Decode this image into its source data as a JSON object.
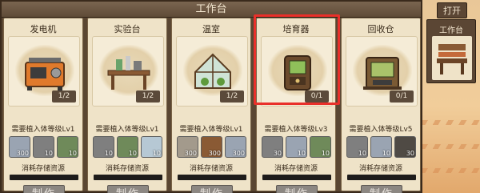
{
  "header": {
    "title": "工作台"
  },
  "side": {
    "open_label": "打开",
    "card_label": "工作台"
  },
  "cards": [
    {
      "name": "发电机",
      "count": "1/2",
      "requirement": "需要植入体等级Lv1",
      "materials": [
        {
          "icon": "crystal-ore-icon",
          "qty": "300"
        },
        {
          "icon": "iron-bar-icon",
          "qty": "10"
        },
        {
          "icon": "circuit-board-icon",
          "qty": "10"
        }
      ],
      "consume_label": "消耗存储资源",
      "make_label": "制作"
    },
    {
      "name": "实验台",
      "count": "1/2",
      "requirement": "需要植入体等级Lv1",
      "materials": [
        {
          "icon": "iron-bar-icon",
          "qty": "10"
        },
        {
          "icon": "circuit-board-icon",
          "qty": "10"
        },
        {
          "icon": "ice-crystal-icon",
          "qty": "10"
        }
      ],
      "consume_label": "消耗存储资源",
      "make_label": "制作"
    },
    {
      "name": "温室",
      "count": "1/2",
      "requirement": "需要植入体等级Lv1",
      "materials": [
        {
          "icon": "stone-icon",
          "qty": "300"
        },
        {
          "icon": "wood-log-icon",
          "qty": "300"
        },
        {
          "icon": "crystal-ore-icon",
          "qty": "300"
        }
      ],
      "consume_label": "消耗存储资源",
      "make_label": "制作"
    },
    {
      "name": "培育器",
      "count": "0/1",
      "requirement": "需要植入体等级Lv3",
      "materials": [
        {
          "icon": "iron-bar-icon",
          "qty": "30"
        },
        {
          "icon": "crystal-ore-icon",
          "qty": "10"
        },
        {
          "icon": "circuit-board-icon",
          "qty": "10"
        }
      ],
      "consume_label": "消耗存储资源",
      "make_label": "制作"
    },
    {
      "name": "回收仓",
      "count": "0/1",
      "requirement": "需要植入体等级Lv5",
      "materials": [
        {
          "icon": "iron-bar-icon",
          "qty": "10"
        },
        {
          "icon": "crystal-ore-icon",
          "qty": "10"
        },
        {
          "icon": "coal-ore-icon",
          "qty": "30"
        }
      ],
      "consume_label": "消耗存储资源",
      "make_label": "制作"
    }
  ]
}
